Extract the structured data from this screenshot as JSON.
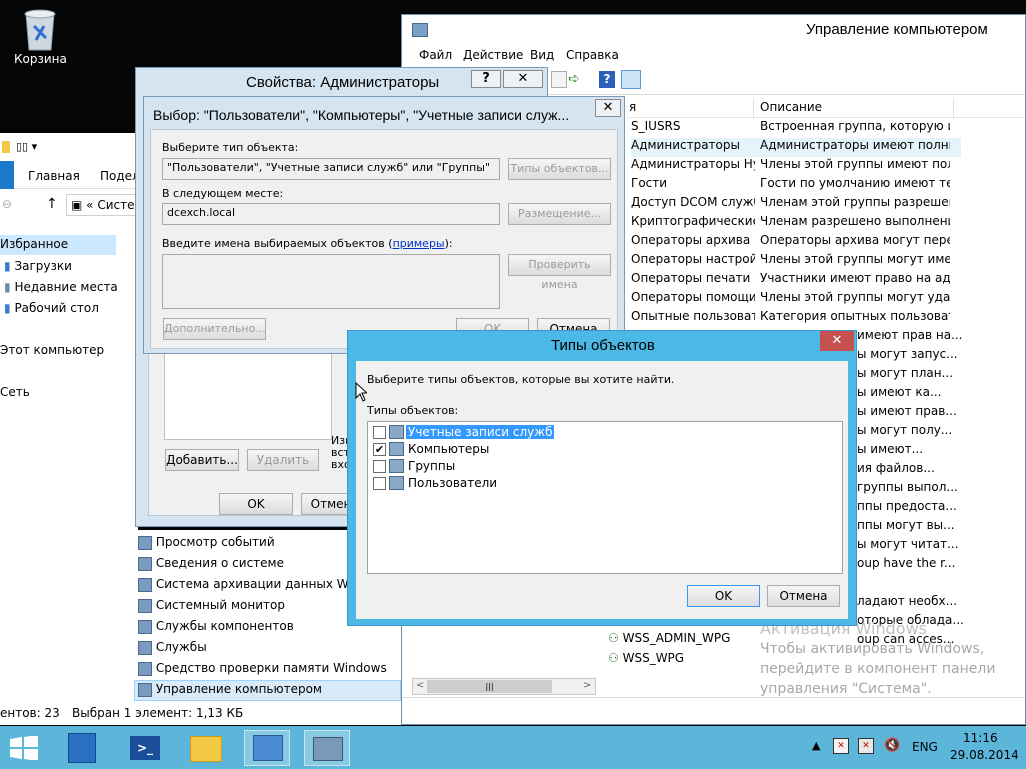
{
  "desktop": {
    "recycle_label": "Корзина"
  },
  "explorer": {
    "tabs": [
      "Главная",
      "Подел"
    ],
    "address": "Систе",
    "nav": [
      "Избранное",
      "Загрузки",
      "Недавние места",
      "Рабочий стол",
      "Этот компьютер",
      "Сеть"
    ],
    "status_count": "ентов: 23",
    "status_selected": "Выбран 1 элемент: 1,13 КБ",
    "tools": [
      "Просмотр событий",
      "Сведения о системе",
      "Система архивации данных Window",
      "Системный монитор",
      "Службы компонентов",
      "Службы",
      "Средство проверки памяти Windows",
      "Управление компьютером"
    ]
  },
  "cm": {
    "title": "Управление компьютером",
    "menu": [
      "Файл",
      "Действие",
      "Вид",
      "Справка"
    ],
    "col_name": "я",
    "col_desc": "Описание",
    "rows": [
      [
        "S_IUSRS",
        "Встроенная группа, которую ис..."
      ],
      [
        "Администраторы",
        "Администраторы имеют полны..."
      ],
      [
        "Администраторы Ну...",
        "Члены этой группы имеют пол..."
      ],
      [
        "Гости",
        "Гости по умолчанию имеют те..."
      ],
      [
        "Доступ DCOM служб...",
        "Членам этой группы разрешено..."
      ],
      [
        "Криптографические ...",
        "Членам разрешено выполнени..."
      ],
      [
        "Операторы архива",
        "Операторы архива могут перео..."
      ],
      [
        "Операторы настройк...",
        "Члены этой группы могут имет..."
      ],
      [
        "Операторы печати",
        "Участники имеют право на адм..."
      ],
      [
        "Операторы помощи ...",
        "Члены этой группы могут удале..."
      ],
      [
        "Опытные пользовате...",
        "Категория опытных пользовате..."
      ]
    ],
    "right_frag": [
      "имеют прав на...",
      "ы могут запус...",
      "ы могут план...",
      "ы имеют ка...",
      "ы имеют прав...",
      "ы могут полу...",
      "ы имеют...",
      "ия файлов...",
      "группы выпол...",
      "ппы предоста...",
      "ппы могут вы...",
      "ы могут читат...",
      "oup have the r...",
      "",
      "ладают необх...",
      "оторые облада...",
      "oup can acces..."
    ],
    "wss": [
      "WSS_ADMIN_WPG",
      "WSS_WPG"
    ],
    "activate": [
      "Активация Windows",
      "Чтобы активировать Windows,",
      "перейдите в компонент панели",
      "управления \"Система\"."
    ]
  },
  "props": {
    "title": "Свойства: Администраторы",
    "help": "?",
    "close": "✕",
    "add": "Добавить...",
    "remove": "Удалить",
    "ok": "OK",
    "cancel": "Отмен",
    "note": "Изм\nвст\nвхо"
  },
  "select": {
    "title": "Выбор: \"Пользователи\", \"Компьютеры\", \"Учетные записи служ...",
    "lbl_type": "Выберите тип объекта:",
    "type_value": "\"Пользователи\", \"Учетные записи служб\" или \"Группы\"",
    "btn_types": "Типы объектов...",
    "lbl_loc": "В следующем месте:",
    "loc_value": "dcexch.local",
    "btn_loc": "Размещение...",
    "lbl_names_a": "Введите имена выбираемых объектов (",
    "lbl_names_link": "примеры",
    "lbl_names_b": "):",
    "btn_check": "Проверить имена",
    "btn_adv": "Дополнительно...",
    "ok": "OK",
    "cancel": "Отмена"
  },
  "types": {
    "title": "Типы объектов",
    "close": "✕",
    "desc": "Выберите типы объектов, которые вы хотите найти.",
    "list_label": "Типы объектов:",
    "items": [
      {
        "label": "Учетные записи служб",
        "checked": false,
        "selected": true
      },
      {
        "label": "Компьютеры",
        "checked": true,
        "selected": false
      },
      {
        "label": "Группы",
        "checked": false,
        "selected": false
      },
      {
        "label": "Пользователи",
        "checked": false,
        "selected": false
      }
    ],
    "ok": "OK",
    "cancel": "Отмена"
  },
  "tray": {
    "lang": "ENG",
    "time": "11:16",
    "date": "29.08.2014"
  },
  "colors": {
    "accent": "#5bb6da",
    "close_red": "#c75050",
    "select_blue": "#3399ff"
  }
}
